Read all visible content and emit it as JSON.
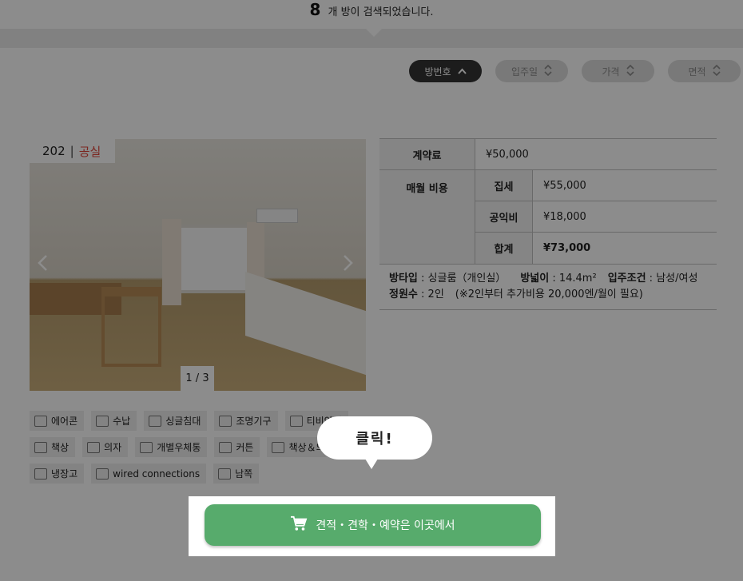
{
  "results": {
    "count": "8",
    "text": "개 방이 검색되었습니다."
  },
  "sort": [
    {
      "label": "방번호",
      "icon": "chevron-up-icon",
      "active": true
    },
    {
      "label": "입주일",
      "icon": "sort-updown-icon",
      "active": false
    },
    {
      "label": "가격",
      "icon": "sort-updown-icon",
      "active": false
    },
    {
      "label": "면적",
      "icon": "sort-updown-icon",
      "active": false
    }
  ],
  "room": {
    "number": "202",
    "separator": "|",
    "status": "공실",
    "photo_counter": "1 / 3",
    "prev_icon": "chevron-left-icon",
    "next_icon": "chevron-right-icon"
  },
  "pricing": {
    "contract_label": "계약료",
    "contract_value": "¥50,000",
    "monthly_label": "매월 비용",
    "rent_label": "집세",
    "rent_value": "¥55,000",
    "fee_label": "공익비",
    "fee_value": "¥18,000",
    "total_label": "합계",
    "total_value": "¥73,000"
  },
  "meta": {
    "type_label": "방타입",
    "type_value": "싱글룸（개인실）",
    "area_label": "방넓이",
    "area_value": "14.4m²",
    "cond_label": "입주조건",
    "cond_value": "남성/여성",
    "cap_label": "정원수",
    "cap_value": "2인",
    "cap_note": "(※2인부터 추가비용 20,000엔/월이 필요)"
  },
  "amenities": {
    "row1": [
      "에어콘",
      "수납",
      "싱글침대",
      "조명기구",
      "티비안테"
    ],
    "row2": [
      "책상",
      "의자",
      "개별우체통",
      "커튼",
      "책상＆의자"
    ],
    "row3": [
      "냉장고",
      "wired connections",
      "남쪽"
    ]
  },
  "cta": {
    "label": "견적・견학・예약은 이곳에서",
    "icon": "cart-icon"
  },
  "bubble": {
    "text": "클릭!"
  },
  "colors": {
    "cta": "#57ab6c",
    "vacant": "#e0453b",
    "active_sort": "#333333"
  }
}
